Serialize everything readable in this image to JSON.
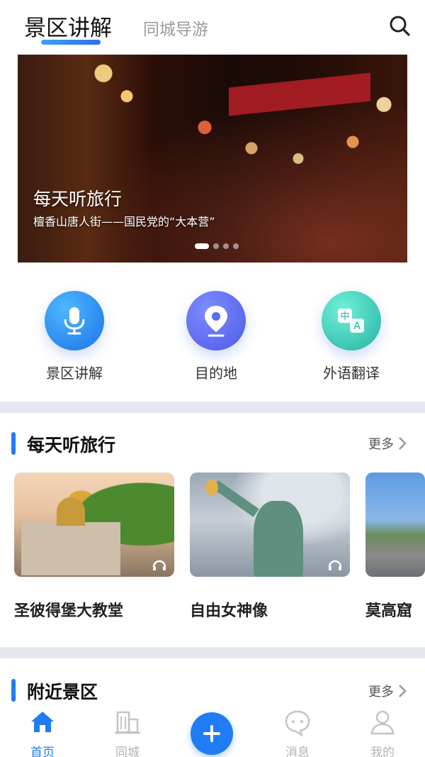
{
  "header": {
    "tab_active": "景区讲解",
    "tab_inactive": "同城导游",
    "search_icon": "search-icon"
  },
  "banner": {
    "title": "每天听旅行",
    "subtitle": "檀香山唐人街——国民党的“大本营”",
    "slide_count": 4,
    "active_slide": 1
  },
  "quick_actions": [
    {
      "label": "景区讲解",
      "icon": "microphone-icon",
      "color": "#2f8ff5"
    },
    {
      "label": "目的地",
      "icon": "location-pin-icon",
      "color": "#5b6cf0"
    },
    {
      "label": "外语翻译",
      "icon": "translate-icon",
      "color": "#34c2b2"
    }
  ],
  "sections": {
    "daily": {
      "title": "每天听旅行",
      "more": "更多"
    },
    "nearby": {
      "title": "附近景区",
      "more": "更多"
    }
  },
  "cards": [
    {
      "name": "圣彼得堡大教堂",
      "icon": "headphones-icon"
    },
    {
      "name": "自由女神像",
      "icon": "headphones-icon"
    },
    {
      "name": "莫高窟",
      "icon": "headphones-icon"
    }
  ],
  "bottom_nav": [
    {
      "label": "首页",
      "icon": "home-icon",
      "active": true
    },
    {
      "label": "同城",
      "icon": "city-building-icon",
      "active": false
    },
    {
      "label": "消息",
      "icon": "chat-bubble-icon",
      "active": false
    },
    {
      "label": "我的",
      "icon": "user-icon",
      "active": false
    }
  ],
  "add_button_icon": "plus-icon",
  "colors": {
    "accent": "#1f7cf4",
    "inactive": "#b3b3b3"
  }
}
